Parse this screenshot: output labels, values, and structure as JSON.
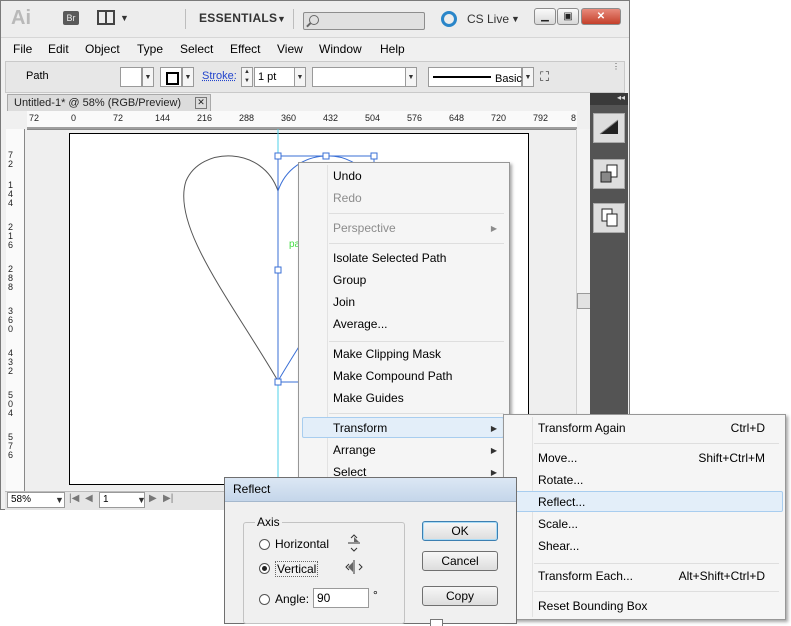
{
  "app": {
    "logo": "Ai",
    "bridge": "Br",
    "workspace": "ESSENTIALS",
    "cs_live": "CS Live",
    "menu": [
      "File",
      "Edit",
      "Object",
      "Type",
      "Select",
      "Effect",
      "View",
      "Window",
      "Help"
    ]
  },
  "control_bar": {
    "object_type": "Path",
    "stroke_label": "Stroke:",
    "stroke_weight": "1 pt",
    "brush_style": "Basic"
  },
  "document": {
    "tab_title": "Untitled-1* @ 58% (RGB/Preview)",
    "zoom": "58%",
    "artboard_number": "1",
    "h_ruler_ticks": [
      "72",
      "0",
      "72",
      "144",
      "216",
      "288",
      "360",
      "432",
      "504",
      "576",
      "648",
      "720",
      "792",
      "8"
    ],
    "v_ruler_ticks": [
      "7 2",
      "1 4 4",
      "2 1 6",
      "2 8 8",
      "3 6 0",
      "4 3 2",
      "5 0 4",
      "5 7 6"
    ],
    "path_label": "pa"
  },
  "context_menu": {
    "items": [
      {
        "label": "Undo",
        "enabled": true
      },
      {
        "label": "Redo",
        "enabled": false
      },
      {
        "label": "Perspective",
        "enabled": false,
        "submenu": true
      },
      {
        "label": "Isolate Selected Path",
        "enabled": true
      },
      {
        "label": "Group",
        "enabled": true
      },
      {
        "label": "Join",
        "enabled": true
      },
      {
        "label": "Average...",
        "enabled": true
      },
      {
        "label": "Make Clipping Mask",
        "enabled": true
      },
      {
        "label": "Make Compound Path",
        "enabled": true
      },
      {
        "label": "Make Guides",
        "enabled": true
      },
      {
        "label": "Transform",
        "enabled": true,
        "submenu": true,
        "highlighted": true
      },
      {
        "label": "Arrange",
        "enabled": true,
        "submenu": true
      },
      {
        "label": "Select",
        "enabled": true,
        "submenu": true
      }
    ]
  },
  "transform_submenu": {
    "items": [
      {
        "label": "Transform Again",
        "shortcut": "Ctrl+D"
      },
      {
        "label": "Move...",
        "shortcut": "Shift+Ctrl+M"
      },
      {
        "label": "Rotate...",
        "shortcut": ""
      },
      {
        "label": "Reflect...",
        "shortcut": "",
        "highlighted": true
      },
      {
        "label": "Scale...",
        "shortcut": ""
      },
      {
        "label": "Shear...",
        "shortcut": ""
      },
      {
        "label": "Transform Each...",
        "shortcut": "Alt+Shift+Ctrl+D"
      },
      {
        "label": "Reset Bounding Box",
        "shortcut": ""
      }
    ]
  },
  "reflect_dialog": {
    "title": "Reflect",
    "axis_group": "Axis",
    "horizontal": "Horizontal",
    "vertical": "Vertical",
    "selected_axis": "Vertical",
    "angle_label": "Angle:",
    "angle_value": "90",
    "degree": "°",
    "ok": "OK",
    "cancel": "Cancel",
    "copy": "Copy"
  },
  "colors": {
    "path_selection": "#3a6fd6",
    "guide": "#4fd0e8",
    "highlight": "#e3eef9",
    "highlight_border": "#a8cdef"
  }
}
